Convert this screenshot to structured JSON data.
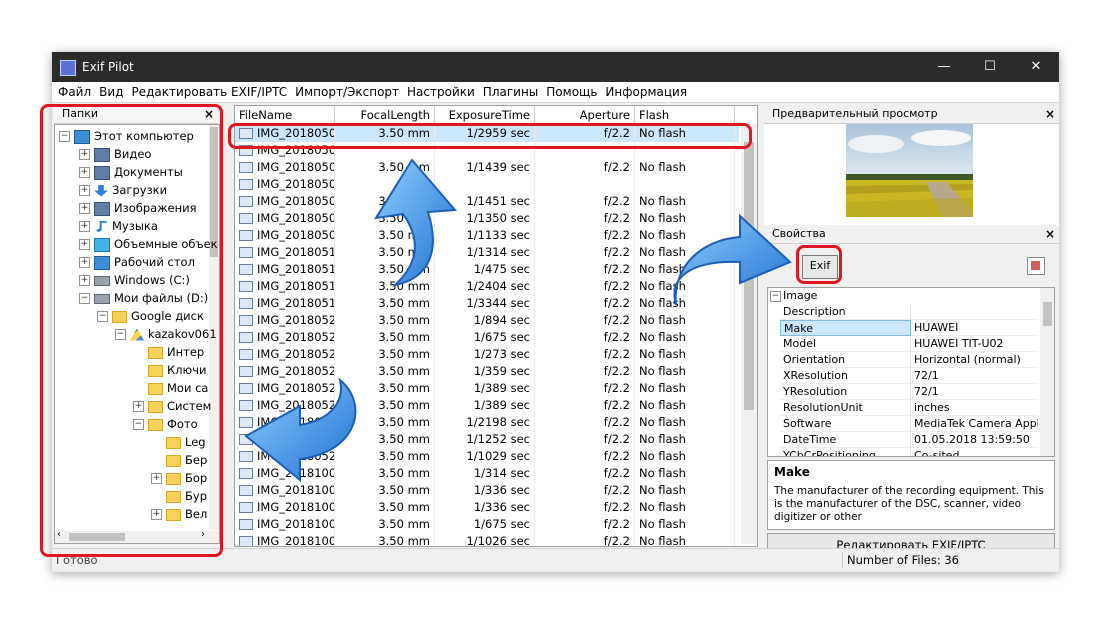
{
  "window": {
    "title": "Exif Pilot",
    "controls": {
      "minimize": "—",
      "maximize": "☐",
      "close": "✕"
    }
  },
  "menu": [
    "Файл",
    "Вид",
    "Редактировать EXIF/IPTC",
    "Импорт/Экспорт",
    "Настройки",
    "Плагины",
    "Помощь",
    "Информация"
  ],
  "folders_panel": {
    "title": "Папки",
    "close": "×",
    "items": [
      {
        "label": "Этот компьютер",
        "expander": "−",
        "icon": "computer-icon"
      },
      {
        "label": "Видео",
        "expander": "+",
        "icon": "video-icon"
      },
      {
        "label": "Документы",
        "expander": "+",
        "icon": "documents-icon"
      },
      {
        "label": "Загрузки",
        "expander": "+",
        "icon": "downloads-icon"
      },
      {
        "label": "Изображения",
        "expander": "+",
        "icon": "images-icon"
      },
      {
        "label": "Музыка",
        "expander": "+",
        "icon": "music-icon"
      },
      {
        "label": "Объемные объек",
        "expander": "+",
        "icon": "3d-objects-icon"
      },
      {
        "label": "Рабочий стол",
        "expander": "+",
        "icon": "desktop-icon"
      },
      {
        "label": "Windows (C:)",
        "expander": "+",
        "icon": "drive-icon"
      },
      {
        "label": "Мои файлы (D:)",
        "expander": "−",
        "icon": "drive-icon"
      },
      {
        "label": "Google диск",
        "expander": "−",
        "icon": "folder-icon"
      },
      {
        "label": "kazakov061",
        "expander": "−",
        "icon": "google-drive-icon"
      },
      {
        "label": "Интер",
        "expander": "",
        "icon": "folder-icon"
      },
      {
        "label": "Ключи",
        "expander": "",
        "icon": "folder-icon"
      },
      {
        "label": "Мои са",
        "expander": "",
        "icon": "folder-icon"
      },
      {
        "label": "Систем",
        "expander": "+",
        "icon": "folder-icon"
      },
      {
        "label": "Фото",
        "expander": "−",
        "icon": "folder-icon"
      },
      {
        "label": "Leg",
        "expander": "",
        "icon": "folder-icon"
      },
      {
        "label": "Бер",
        "expander": "",
        "icon": "folder-icon"
      },
      {
        "label": "Бор",
        "expander": "+",
        "icon": "folder-icon"
      },
      {
        "label": "Бур",
        "expander": "",
        "icon": "folder-icon"
      },
      {
        "label": "Вел",
        "expander": "+",
        "icon": "folder-icon"
      }
    ]
  },
  "file_list": {
    "columns": [
      "FileName",
      "FocalLength",
      "ExposureTime",
      "Aperture",
      "Flash"
    ],
    "rows": [
      [
        "IMG_2018050...",
        "3.50 mm",
        "1/2959 sec",
        "f/2.2",
        "No flash"
      ],
      [
        "IMG_2018050...",
        "",
        "",
        "",
        ""
      ],
      [
        "IMG_2018050...",
        "3.50 mm",
        "1/1439 sec",
        "f/2.2",
        "No flash"
      ],
      [
        "IMG_2018050...",
        "",
        "",
        "",
        ""
      ],
      [
        "IMG_2018050...",
        "3.50 mm",
        "1/1451 sec",
        "f/2.2",
        "No flash"
      ],
      [
        "IMG_2018050...",
        "3.50 mm",
        "1/1350 sec",
        "f/2.2",
        "No flash"
      ],
      [
        "IMG_2018050...",
        "3.50 mm",
        "1/1133 sec",
        "f/2.2",
        "No flash"
      ],
      [
        "IMG_2018051...",
        "3.50 mm",
        "1/1314 sec",
        "f/2.2",
        "No flash"
      ],
      [
        "IMG_2018051...",
        "3.50 mm",
        "1/475 sec",
        "f/2.2",
        "No flash"
      ],
      [
        "IMG_2018051...",
        "3.50 mm",
        "1/2404 sec",
        "f/2.2",
        "No flash"
      ],
      [
        "IMG_2018051...",
        "3.50 mm",
        "1/3344 sec",
        "f/2.2",
        "No flash"
      ],
      [
        "IMG_2018052...",
        "3.50 mm",
        "1/894 sec",
        "f/2.2",
        "No flash"
      ],
      [
        "IMG_2018052...",
        "3.50 mm",
        "1/675 sec",
        "f/2.2",
        "No flash"
      ],
      [
        "IMG_2018052...",
        "3.50 mm",
        "1/273 sec",
        "f/2.2",
        "No flash"
      ],
      [
        "IMG_2018052...",
        "3.50 mm",
        "1/359 sec",
        "f/2.2",
        "No flash"
      ],
      [
        "IMG_2018052...",
        "3.50 mm",
        "1/389 sec",
        "f/2.2",
        "No flash"
      ],
      [
        "IMG_2018052...",
        "3.50 mm",
        "1/389 sec",
        "f/2.2",
        "No flash"
      ],
      [
        "IMG_2018052...",
        "3.50 mm",
        "1/2198 sec",
        "f/2.2",
        "No flash"
      ],
      [
        "IMG_2018052...",
        "3.50 mm",
        "1/1252 sec",
        "f/2.2",
        "No flash"
      ],
      [
        "IMG_2018052...",
        "3.50 mm",
        "1/1029 sec",
        "f/2.2",
        "No flash"
      ],
      [
        "IMG_2018100...",
        "3.50 mm",
        "1/314 sec",
        "f/2.2",
        "No flash"
      ],
      [
        "IMG_2018100...",
        "3.50 mm",
        "1/336 sec",
        "f/2.2",
        "No flash"
      ],
      [
        "IMG_2018100...",
        "3.50 mm",
        "1/336 sec",
        "f/2.2",
        "No flash"
      ],
      [
        "IMG_2018100...",
        "3.50 mm",
        "1/675 sec",
        "f/2.2",
        "No flash"
      ],
      [
        "IMG_2018100...",
        "3.50 mm",
        "1/1026 sec",
        "f/2.2",
        "No flash"
      ]
    ]
  },
  "preview_panel": {
    "title": "Предварительный просмотр",
    "close": "×"
  },
  "properties_panel": {
    "title": "Свойства",
    "close": "×",
    "exif_button": "Exif",
    "group": "Image",
    "rows": [
      {
        "name": "Description",
        "value": ""
      },
      {
        "name": "Make",
        "value": "HUAWEI"
      },
      {
        "name": "Model",
        "value": "HUAWEI TIT-U02"
      },
      {
        "name": "Orientation",
        "value": "Horizontal (normal)"
      },
      {
        "name": "XResolution",
        "value": "72/1"
      },
      {
        "name": "YResolution",
        "value": "72/1"
      },
      {
        "name": "ResolutionUnit",
        "value": "inches"
      },
      {
        "name": "Software",
        "value": "MediaTek Camera Appl..."
      },
      {
        "name": "DateTime",
        "value": "01.05.2018 13:59:50"
      },
      {
        "name": "YCbCrPositioning",
        "value": "Co-sited"
      }
    ],
    "description_title": "Make",
    "description_text": "The manufacturer of the recording equipment. This is the manufacturer of the DSC, scanner, video digitizer or other",
    "edit_button": "Редактировать EXIF/IPTC"
  },
  "status": {
    "left": "Готово",
    "right": "Number of Files: 36"
  },
  "colors": {
    "highlight": "#e0171f",
    "arrow": "#2f8fe8",
    "titlebar": "#2b2b2b",
    "selected_row": "#cce8ff"
  }
}
